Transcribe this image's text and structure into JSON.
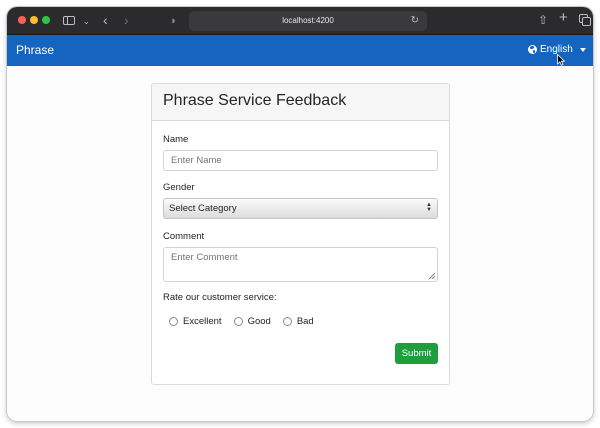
{
  "browser": {
    "url": "localhost:4200"
  },
  "navbar": {
    "brand": "Phrase",
    "language": "English",
    "colors": {
      "background": "#1565c0",
      "text": "#ffffff"
    }
  },
  "form": {
    "title": "Phrase Service Feedback",
    "name": {
      "label": "Name",
      "placeholder": "Enter Name"
    },
    "gender": {
      "label": "Gender",
      "selected": "Select Category"
    },
    "comment": {
      "label": "Comment",
      "placeholder": "Enter Comment"
    },
    "rating": {
      "label": "Rate our customer service:",
      "options": [
        "Excellent",
        "Good",
        "Bad"
      ]
    },
    "submit_label": "Submit",
    "submit_color": "#1e9e3e"
  }
}
